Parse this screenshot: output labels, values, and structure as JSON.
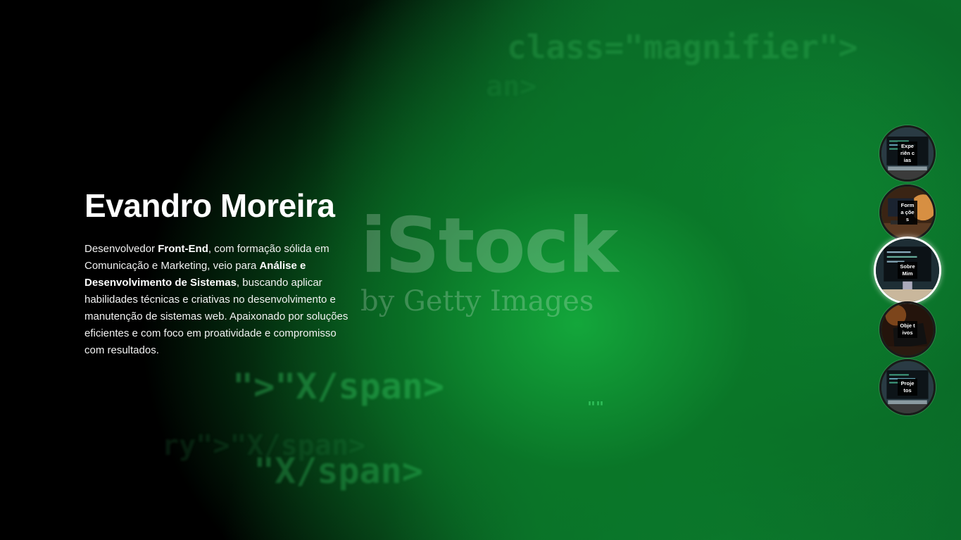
{
  "watermark": {
    "brand": "iStock",
    "sub": "by Getty Images"
  },
  "code_snippets": [
    "class=\"magnifier\">",
    "an>",
    "\">\"X/span>",
    "\"X/span>",
    "ry\">\"X/span>",
    "\"\""
  ],
  "hero": {
    "name": "Evandro Moreira",
    "bio_1": "Desenvolvedor ",
    "bio_bold_1": "Front-End",
    "bio_2": ", com formação sólida em Comunicação e Marketing, veio para ",
    "bio_bold_2": "Análise e Desenvolvimento de Sistemas",
    "bio_3": ", buscando aplicar habilidades técnicas e criativas no desenvolvimento e manutenção de sistemas web. Apaixonado por soluções eficientes e com foco em proatividade e compromisso com resultados."
  },
  "nav": [
    {
      "label": "Expe riên cias",
      "thumb": "monitor"
    },
    {
      "label": "Forma ções",
      "thumb": "desk-lamp"
    },
    {
      "label": "Sobre Mim",
      "thumb": "monitor",
      "active": true
    },
    {
      "label": "Obje tivos",
      "thumb": "laptop-dark"
    },
    {
      "label": "Proje tos",
      "thumb": "monitor"
    }
  ]
}
